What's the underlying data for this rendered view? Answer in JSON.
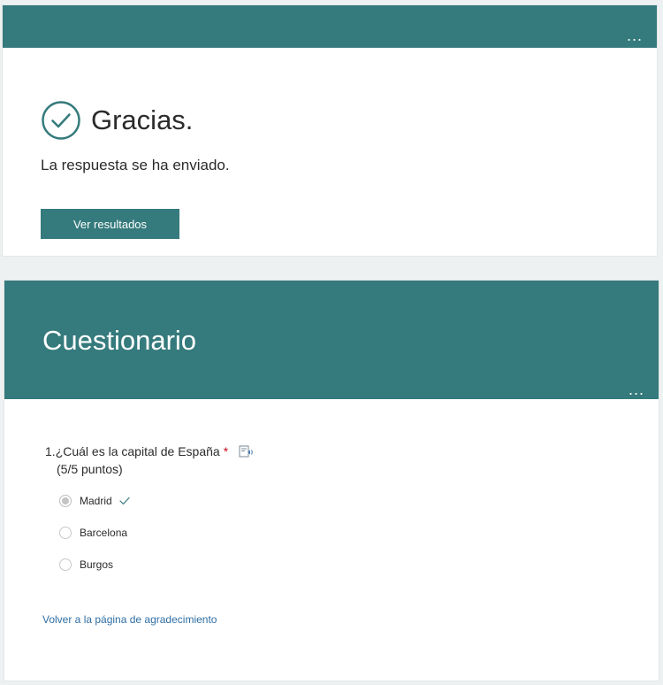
{
  "colors": {
    "accent": "#357a7c",
    "required": "#c50f1f",
    "link": "#2f6ea3"
  },
  "thanks_card": {
    "more_label": "...",
    "title": "Gracias.",
    "message": "La respuesta se ha enviado.",
    "results_button": "Ver resultados",
    "icon": "check-circle-icon"
  },
  "quiz_card": {
    "title": "Cuestionario",
    "more_label": "...",
    "question": {
      "number": "1.",
      "text": "¿Cuál es la capital de España",
      "required_mark": "*",
      "points": "(5/5 puntos)",
      "reader_icon": "immersive-reader-icon",
      "options": [
        {
          "label": "Madrid",
          "selected": true,
          "correct": true
        },
        {
          "label": "Barcelona",
          "selected": false,
          "correct": false
        },
        {
          "label": "Burgos",
          "selected": false,
          "correct": false
        }
      ]
    },
    "back_link": "Volver a la página de agradecimiento"
  }
}
